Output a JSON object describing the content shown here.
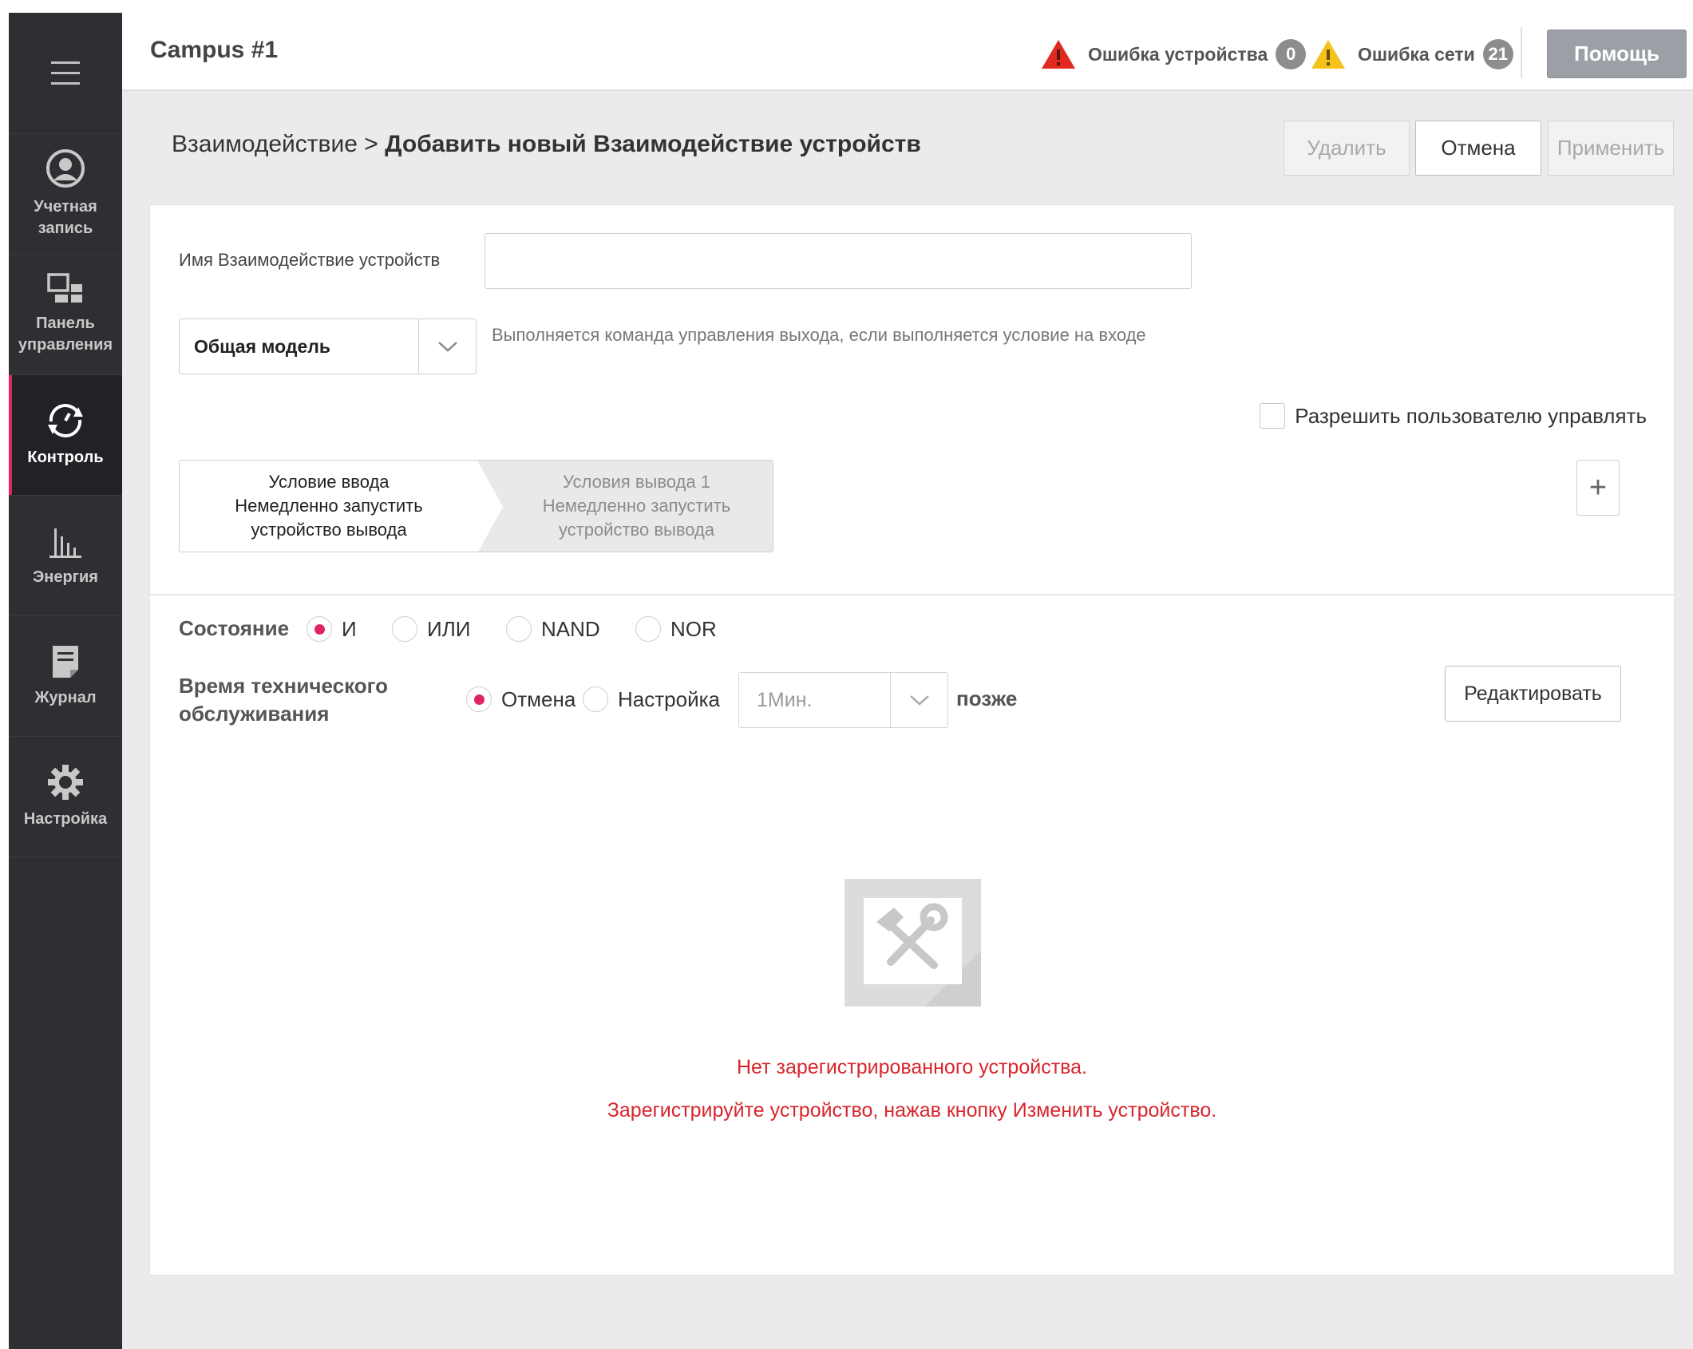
{
  "header": {
    "campus": "Campus #1",
    "device_error_label": "Ошибка устройства",
    "device_error_count": "0",
    "network_error_label": "Ошибка сети",
    "network_error_count": "21",
    "help_label": "Помощь"
  },
  "sidebar": {
    "items": [
      {
        "label": "Учетная запись",
        "icon": "account-icon"
      },
      {
        "label": "Панель управления",
        "icon": "dashboard-icon"
      },
      {
        "label": "Контроль",
        "icon": "control-icon",
        "active": true
      },
      {
        "label": "Энергия",
        "icon": "energy-icon"
      },
      {
        "label": "Журнал",
        "icon": "journal-icon"
      },
      {
        "label": "Настройка",
        "icon": "settings-gear-icon"
      }
    ]
  },
  "breadcrumb": {
    "parent": "Взаимодействие",
    "separator": ">",
    "current": "Добавить новый Взаимодействие устройств"
  },
  "actions": {
    "delete": "Удалить",
    "cancel": "Отмена",
    "apply": "Применить"
  },
  "form": {
    "name_label": "Имя Взаимодействие устройств",
    "name_value": "",
    "model_value": "Общая модель",
    "model_hint": "Выполняется команда управления выхода, если выполняется условие на входе",
    "allow_user_control": "Разрешить пользователю управлять",
    "steps": [
      {
        "title": "Условие ввода",
        "line2": "Немедленно запустить",
        "line3": "устройство вывода"
      },
      {
        "title": "Условия вывода 1",
        "line2": "Немедленно запустить",
        "line3": "устройство вывода"
      }
    ],
    "add_label": "+",
    "state_label": "Состояние",
    "state_options": [
      "И",
      "ИЛИ",
      "NAND",
      "NOR"
    ],
    "state_selected": "И",
    "maintenance_label_1": "Время технического",
    "maintenance_label_2": "обслуживания",
    "maintenance_options": [
      "Отмена",
      "Настройка"
    ],
    "maintenance_selected": "Отмена",
    "time_value": "1Мин.",
    "later_label": "позже",
    "edit_label": "Редактировать"
  },
  "empty": {
    "line1": "Нет зарегистрированного устройства.",
    "line2": "Зарегистрируйте устройство, нажав кнопку Изменить устройство."
  },
  "colors": {
    "accent": "#e0245e",
    "sidebar": "#2e2f33",
    "error_text": "#d8262e",
    "warning_red": "#e02a1f",
    "warning_yellow": "#f4c21b"
  }
}
